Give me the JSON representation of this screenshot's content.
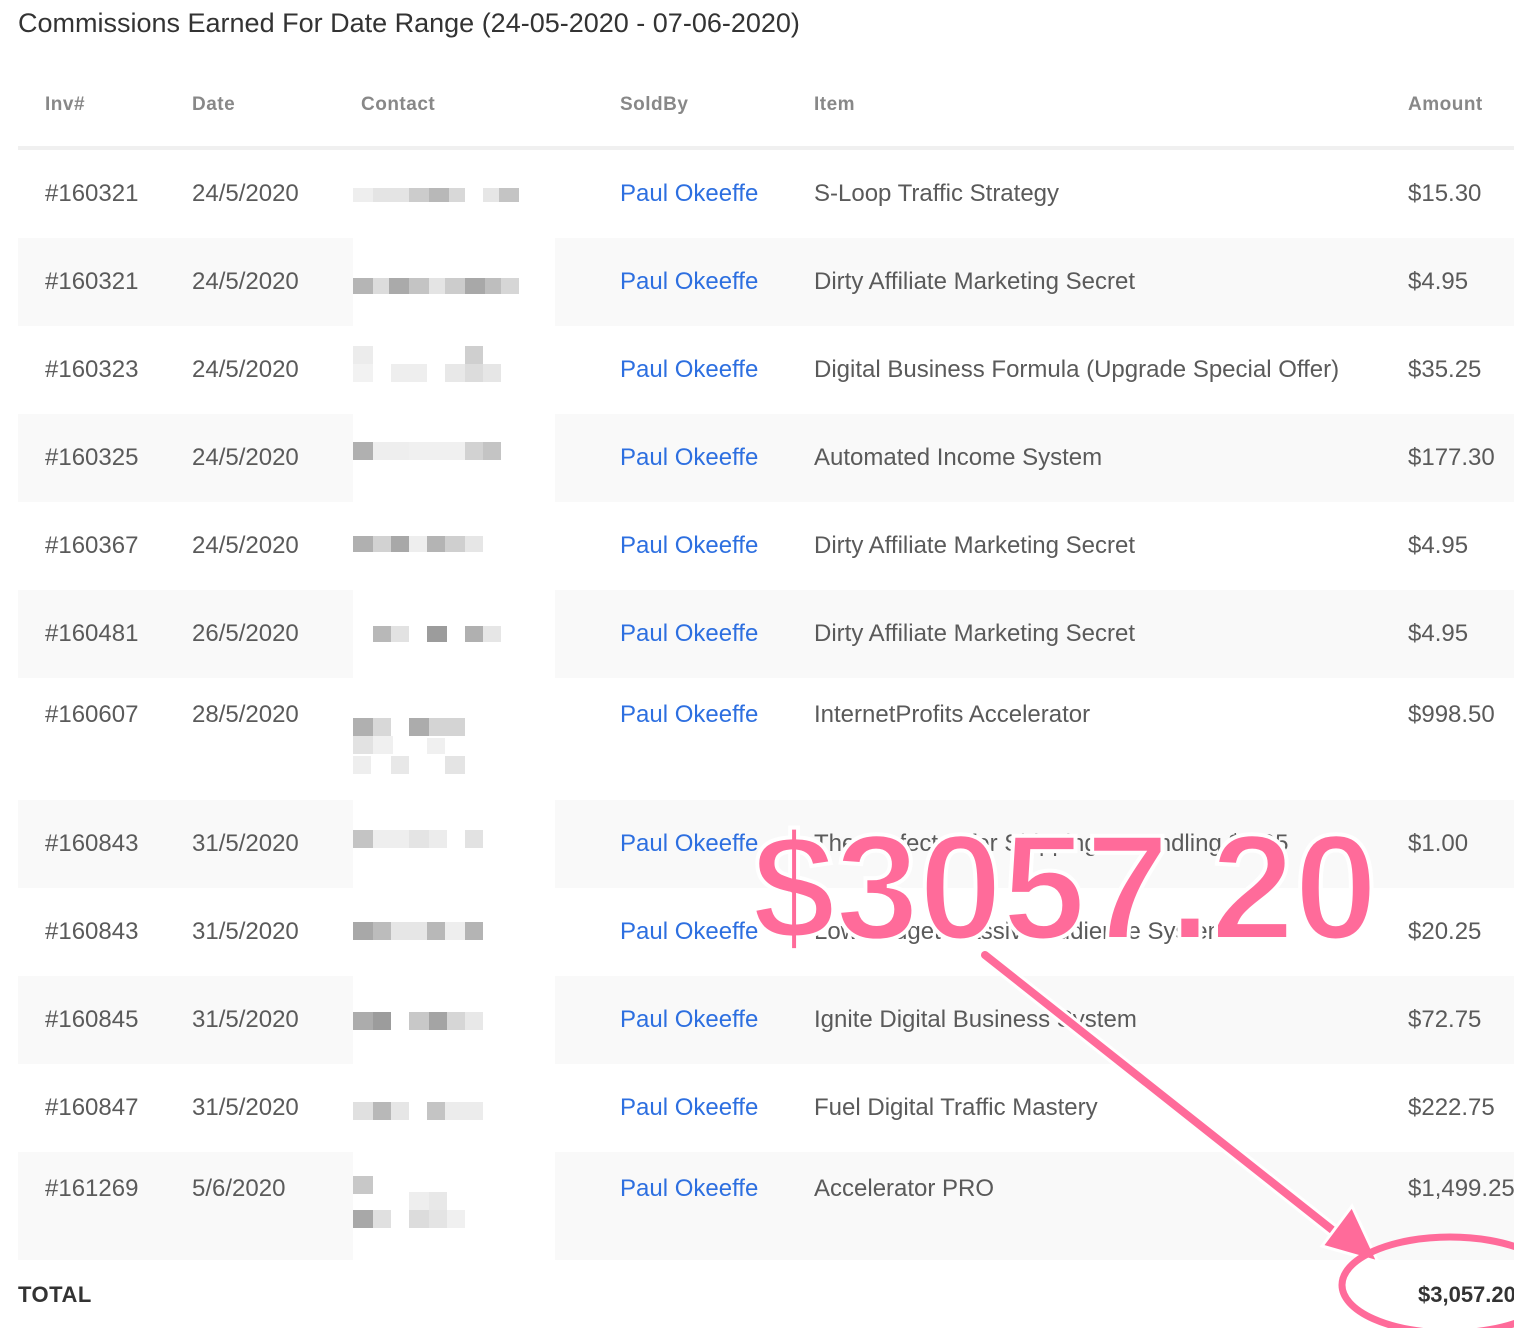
{
  "page": {
    "title": "Commissions Earned For Date Range (24-05-2020 - 07-06-2020)"
  },
  "table": {
    "headers": {
      "inv": "Inv#",
      "date": "Date",
      "contact": "Contact",
      "soldby": "SoldBy",
      "item": "Item",
      "amount": "Amount"
    },
    "rows": [
      {
        "inv": "#160321",
        "date": "24/5/2020",
        "soldby": "Paul Okeeffe",
        "item": "S-Loop Traffic Strategy",
        "amount": "$15.30"
      },
      {
        "inv": "#160321",
        "date": "24/5/2020",
        "soldby": "Paul Okeeffe",
        "item": "Dirty Affiliate Marketing Secret",
        "amount": "$4.95"
      },
      {
        "inv": "#160323",
        "date": "24/5/2020",
        "soldby": "Paul Okeeffe",
        "item": "Digital Business Formula (Upgrade Special Offer)",
        "amount": "$35.25"
      },
      {
        "inv": "#160325",
        "date": "24/5/2020",
        "soldby": "Paul Okeeffe",
        "item": "Automated Income System",
        "amount": "$177.30"
      },
      {
        "inv": "#160367",
        "date": "24/5/2020",
        "soldby": "Paul Okeeffe",
        "item": "Dirty Affiliate Marketing Secret",
        "amount": "$4.95"
      },
      {
        "inv": "#160481",
        "date": "26/5/2020",
        "soldby": "Paul Okeeffe",
        "item": "Dirty Affiliate Marketing Secret",
        "amount": "$4.95"
      },
      {
        "inv": "#160607",
        "date": "28/5/2020",
        "soldby": "Paul Okeeffe",
        "item": "InternetProfits Accelerator",
        "amount": "$998.50"
      },
      {
        "inv": "#160843",
        "date": "31/5/2020",
        "soldby": "Paul Okeeffe",
        "item": "The Perfect Offer Shipping & Handling $6.95",
        "amount": "$1.00"
      },
      {
        "inv": "#160843",
        "date": "31/5/2020",
        "soldby": "Paul Okeeffe",
        "item": "Low Budget Massive Audience System",
        "amount": "$20.25"
      },
      {
        "inv": "#160845",
        "date": "31/5/2020",
        "soldby": "Paul Okeeffe",
        "item": "Ignite Digital Business System",
        "amount": "$72.75"
      },
      {
        "inv": "#160847",
        "date": "31/5/2020",
        "soldby": "Paul Okeeffe",
        "item": "Fuel Digital Traffic Mastery",
        "amount": "$222.75"
      },
      {
        "inv": "#161269",
        "date": "5/6/2020",
        "soldby": "Paul Okeeffe",
        "item": "Accelerator PRO",
        "amount": "$1,499.25"
      }
    ]
  },
  "total": {
    "label": "TOTAL",
    "value": "$3,057.20"
  },
  "annotation": {
    "amount_text": "$3057.20",
    "color": "#ff6b9a"
  },
  "colors": {
    "soldby_link": "#2d6fe0",
    "row_shade": "#f9f9f9"
  }
}
